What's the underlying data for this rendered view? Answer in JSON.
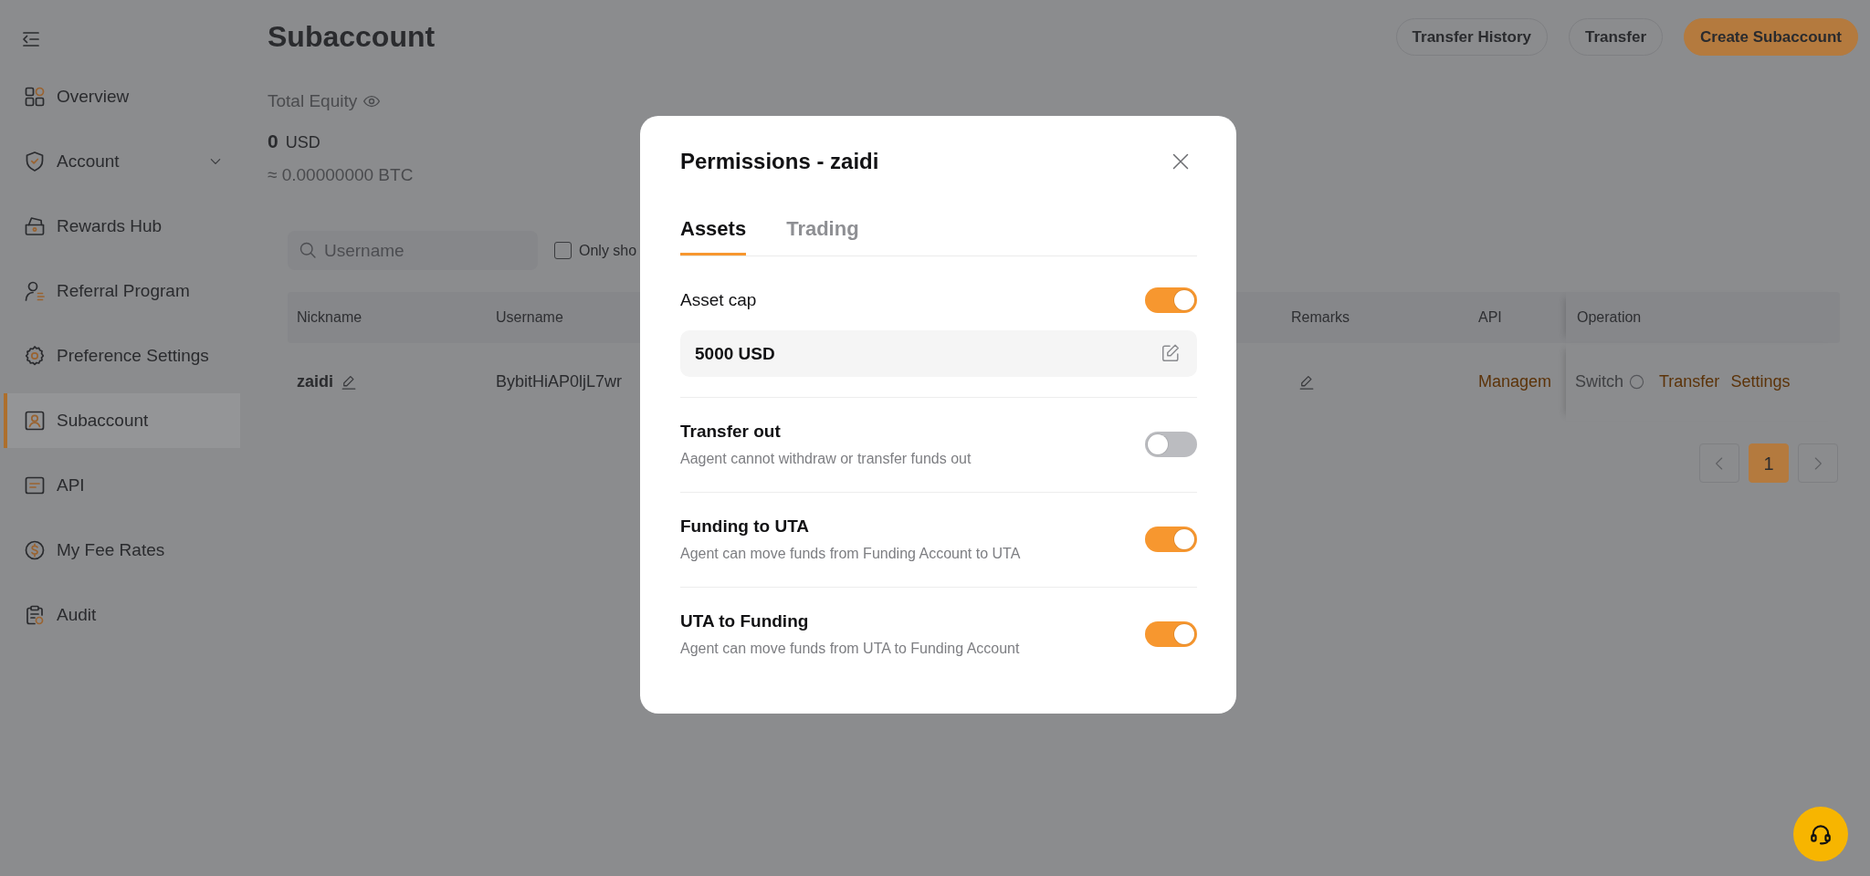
{
  "sidebar": {
    "items": [
      {
        "label": "Overview",
        "kind": "link",
        "selected": false
      },
      {
        "label": "Account",
        "kind": "group",
        "expanded": false,
        "selected": false
      },
      {
        "label": "Rewards Hub",
        "kind": "link",
        "selected": false
      },
      {
        "label": "Referral Program",
        "kind": "link",
        "selected": false
      },
      {
        "label": "Preference Settings",
        "kind": "link",
        "selected": false
      },
      {
        "label": "Subaccount",
        "kind": "link",
        "selected": true
      },
      {
        "label": "API",
        "kind": "link",
        "selected": false
      },
      {
        "label": "My Fee Rates",
        "kind": "link",
        "selected": false
      },
      {
        "label": "Audit",
        "kind": "link",
        "selected": false
      }
    ]
  },
  "header": {
    "title": "Subaccount",
    "actions": [
      {
        "label": "Transfer History",
        "kind": "outline"
      },
      {
        "label": "Transfer",
        "kind": "outline"
      },
      {
        "label": "Create Subaccount",
        "kind": "primary"
      }
    ]
  },
  "equity": {
    "label": "Total Equity",
    "amount": "0",
    "currency": "USD",
    "btc_estimate": "≈ 0.00000000 BTC"
  },
  "filter": {
    "search_placeholder": "Username",
    "checkbox_label": "Only sho",
    "checked": false
  },
  "table": {
    "columns": [
      "Nickname",
      "Username",
      "Remarks",
      "API",
      "Operation"
    ],
    "rows": [
      {
        "nickname": "zaidi",
        "username": "BybitHiAP0ljL7wr",
        "api": "Managem",
        "operations": [
          {
            "label": "Switch",
            "kind": "switch",
            "disabled": true
          },
          {
            "label": "Transfer",
            "kind": "link",
            "disabled": false
          },
          {
            "label": "Settings",
            "kind": "link",
            "disabled": false
          }
        ]
      }
    ]
  },
  "pagination": {
    "pages": [
      {
        "label": "1",
        "selected": true
      }
    ]
  },
  "modal": {
    "title": "Permissions - zaidi",
    "tabs": [
      {
        "label": "Assets",
        "selected": true
      },
      {
        "label": "Trading",
        "selected": false
      }
    ],
    "asset_cap": {
      "label": "Asset cap",
      "on": true,
      "value": "5000 USD"
    },
    "permissions": [
      {
        "title": "Transfer out",
        "description": "Aagent cannot withdraw or transfer funds out",
        "on": false
      },
      {
        "title": "Funding to UTA",
        "description": "Agent can move funds from Funding Account to UTA",
        "on": true
      },
      {
        "title": "UTA to Funding",
        "description": "Agent can move funds from UTA to Funding Account",
        "on": true
      }
    ]
  }
}
